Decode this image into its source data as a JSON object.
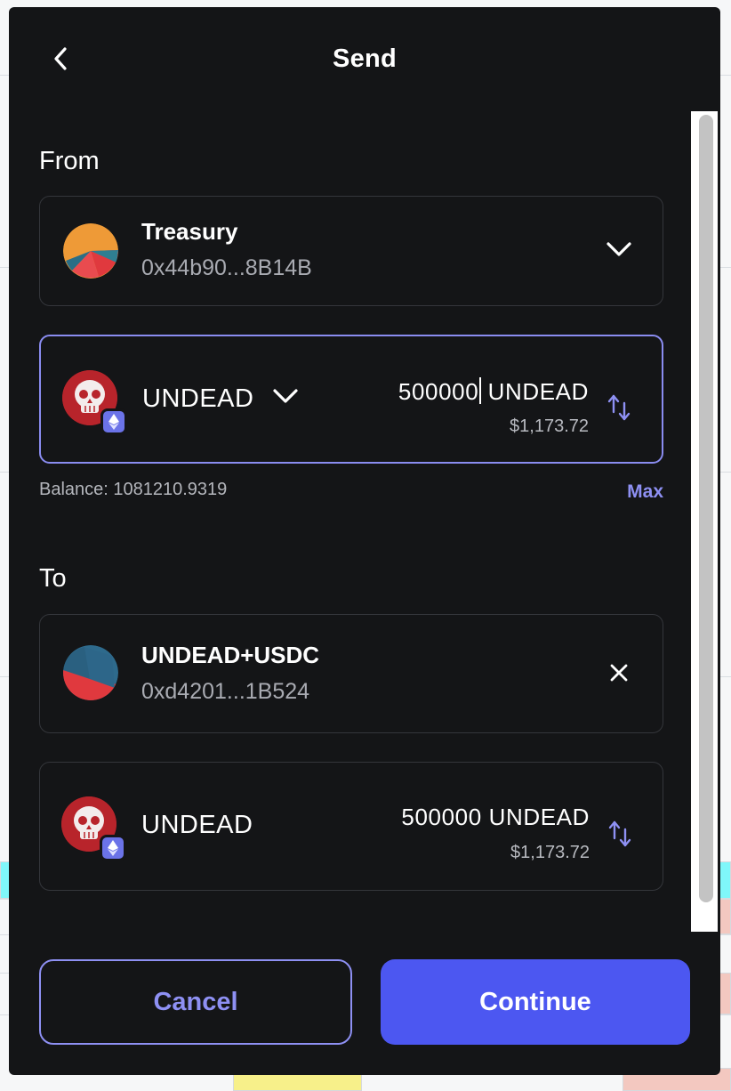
{
  "header": {
    "title": "Send"
  },
  "from": {
    "label": "From",
    "account": {
      "name": "Treasury",
      "address": "0x44b90...8B14B"
    },
    "asset": {
      "token": "UNDEAD",
      "amount": "500000",
      "unit": "UNDEAD",
      "fiat": "$1,173.72"
    },
    "balance_label": "Balance: 1081210.9319",
    "max_label": "Max"
  },
  "to": {
    "label": "To",
    "account": {
      "name": "UNDEAD+USDC",
      "address": "0xd4201...1B524"
    },
    "asset": {
      "token": "UNDEAD",
      "amount": "500000",
      "unit": "UNDEAD",
      "fiat": "$1,173.72"
    }
  },
  "actions": {
    "cancel": "Cancel",
    "continue": "Continue"
  },
  "icons": {
    "back": "chevron-left-icon",
    "account_dropdown": "chevron-down-icon",
    "token_dropdown": "chevron-down-icon",
    "swap": "swap-vertical-icon",
    "clear": "close-icon",
    "network": "ethereum-icon"
  },
  "colors": {
    "background": "#141517",
    "accent": "#8e90f3",
    "primary_button": "#4c57f1",
    "card_border": "#34363b"
  }
}
